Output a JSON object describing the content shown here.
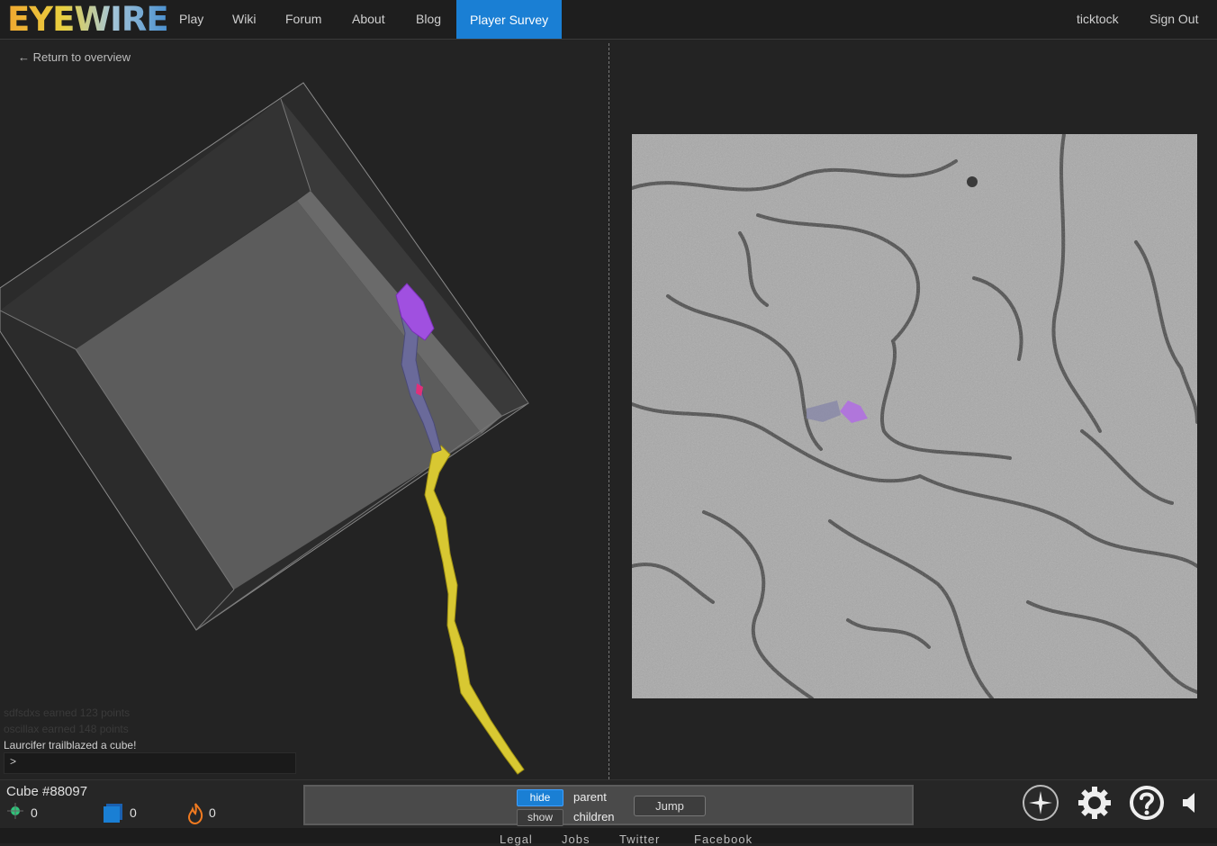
{
  "nav": {
    "logo": "EYEWIRE",
    "items": [
      "Play",
      "Wiki",
      "Forum",
      "About",
      "Blog",
      "Player Survey"
    ],
    "user": "ticktock",
    "sign_out": "Sign Out"
  },
  "return_link": "← Return to overview",
  "chat": {
    "lines": [
      "sdfsdxs earned 123 points",
      "oscillax earned 148 points",
      "Laurcifer trailblazed a cube!"
    ],
    "prompt": ">"
  },
  "status": {
    "cube": "Cube #88097",
    "trailblazes": "0",
    "cubes": "0",
    "streak": "0"
  },
  "controls": {
    "hide": "hide",
    "show": "show",
    "parent": "parent",
    "children": "children",
    "jump": "Jump"
  },
  "footer": {
    "links": [
      "Legal",
      "Jobs",
      "Twitter",
      "Facebook"
    ]
  },
  "colors": {
    "accent": "#1a7fd4",
    "segment_yellow": "#d8c832",
    "segment_purple": "#a050e0",
    "segment_slate": "#6a6a9a",
    "segment_pink": "#e0307a"
  },
  "icons": [
    "compass-icon",
    "gear-icon",
    "help-icon",
    "speaker-icon",
    "trailblaze-icon",
    "cube-count-icon",
    "flame-icon"
  ]
}
